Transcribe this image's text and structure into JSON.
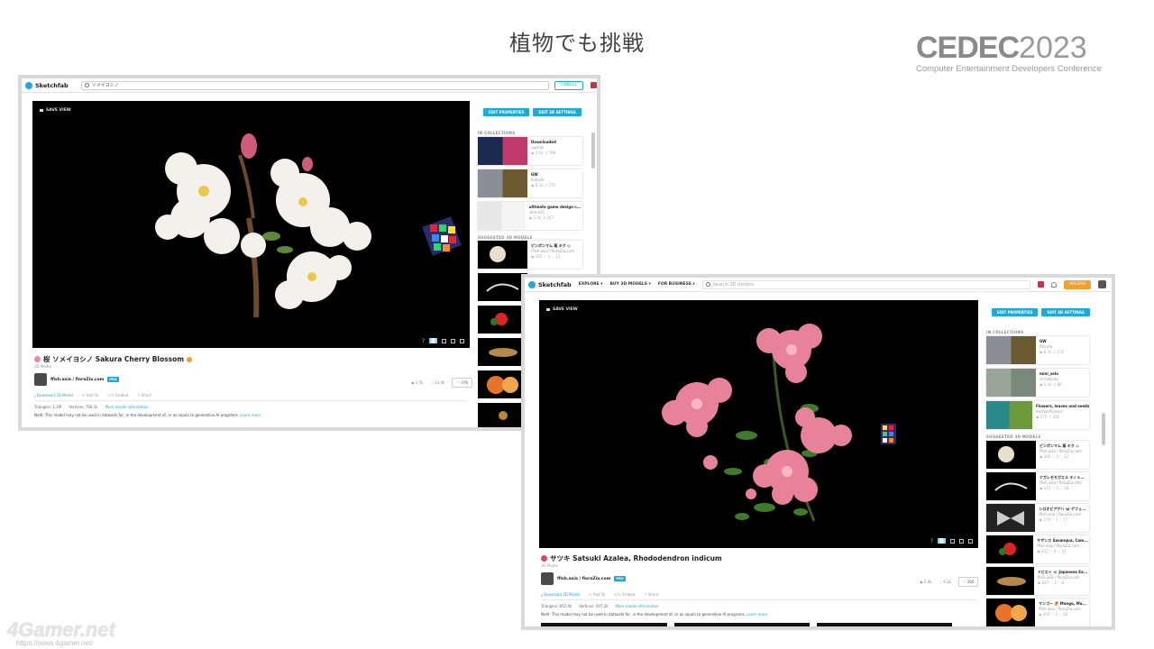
{
  "slide": {
    "title": "植物でも挑戦",
    "logo_main": "CEDEC",
    "logo_year": "2023",
    "logo_sub": "Computer Entertainment Developers Conference",
    "watermark": "4Gamer.net",
    "watermark_url": "https://www.4gamer.net/"
  },
  "colors": {
    "accent": "#1caad9",
    "upload": "#f0a030",
    "viewer_bg": "#000000"
  },
  "win1": {
    "brand": "Sketchfab",
    "search_value": "ソメイヨシノ",
    "cancel": "CANCEL",
    "save_view": "SAVE VIEW",
    "buttons": [
      "EDIT PROPERTIES",
      "EDIT 3D SETTINGS"
    ],
    "collections_head": "IN COLLECTIONS",
    "collections": [
      {
        "title": "Downloaded",
        "sub": "uuishik",
        "stats": "◉ 2.1k  ♫ 798"
      },
      {
        "title": "GW",
        "sub": "fistrufe",
        "stats": "◉ 6.1k  ♫ 272"
      },
      {
        "title": "ultimate game design c...",
        "sub": "sharnl21",
        "stats": "◉ 2.5k  ♫ 267"
      }
    ],
    "suggested_head": "SUGGESTED 3D MODELS",
    "suggested": [
      {
        "title": "ピンポンマム 菊 キク ◎",
        "sub": "Ffish.asia / floraZia.com",
        "stats": "◉ 192  ♡ 3  ◌ 12"
      }
    ],
    "model_title": "桜 ソメイヨシノ Sakura Cherry Blossom",
    "model_sub": "3D Model",
    "author": "ffish.asia / floraZia.com",
    "pro": "PRO",
    "views": "◉ 3.5k",
    "comments": "◌ 14.0k",
    "like": "♡ 379",
    "actions": [
      "⤓ Download 3D Model",
      "+ Add To",
      "</> Embed",
      "⇪ Share"
    ],
    "triangles": "Triangles: 1.1M",
    "vertices": "Vertices: 766.1k",
    "more_info": "More model information",
    "notice": "NoAI: This model may not be used in datasets for, in the development of, or as inputs to generative AI programs.",
    "learn_more": "Learn more"
  },
  "win2": {
    "brand": "Sketchfab",
    "nav": [
      "EXPLORE ▾",
      "BUY 3D MODELS ▾",
      "FOR BUSINESS ▾"
    ],
    "search_placeholder": "Search 3D models",
    "upload": "UPLOAD",
    "save_view": "SAVE VIEW",
    "buttons": [
      "EDIT PROPERTIES",
      "EDIT 3D SETTINGS"
    ],
    "collections_head": "IN COLLECTIONS",
    "collections": [
      {
        "title": "GW",
        "sub": "fistrufe",
        "stats": "◉ 6.1k  ♫ 272"
      },
      {
        "title": "mini_sela",
        "sub": "chrisbasky",
        "stats": "◉ 2.1k  ♫ 80"
      },
      {
        "title": "Flowers, leaves and seeds",
        "sub": "michaelfvisual",
        "stats": "◉ 277  ♫ 201"
      }
    ],
    "suggested_head": "SUGGESTED 3D MODELS",
    "suggested": [
      {
        "title": "ピンポンマム 菊 キク ◎",
        "sub": "ffish.asia / floraZia.com",
        "stats": "◉ 192  ♡ 3  ◌ 12"
      },
      {
        "title": "ナガレモモガエル キノメ...",
        "sub": "ffish.asia / floraZia.com",
        "stats": "◉ 372  ♡ 4  ◌ 16"
      },
      {
        "title": "シロオビアゲハ 🦋 ゲフェ...",
        "sub": "ffish.asia / floraZia.com",
        "stats": "◉ 274  ♡ 3  ◌ 17"
      },
      {
        "title": "サザンカ Sasanqua, Cam...",
        "sub": "ffish.asia / floraZia.com",
        "stats": "◉ 232  ♡ 4  ◌ 10"
      },
      {
        "title": "ドビエイ 🐟 Japanese Ea...",
        "sub": "ffish.asia / floraZia.com",
        "stats": "◉ 227  ♡ 4  ◌ 6"
      },
      {
        "title": "マンゴー 🥭 Mango, Ma...",
        "sub": "ffish.asia / floraZia.com",
        "stats": "◉ 303  ♡ 3  ◌ 16"
      }
    ],
    "model_title": "サツキ Satsuki Azalea, Rhododendron indicum",
    "model_sub": "3D Model",
    "author": "ffish.asia / floraZia.com",
    "pro": "PRO",
    "views": "◉ 2.4k",
    "comments": "◌ 4.1k",
    "like": "♡ 166",
    "actions": [
      "⤓ Download 3D Model",
      "+ Add To",
      "</> Embed",
      "⇪ Share"
    ],
    "triangles": "Triangles: 852.4k",
    "vertices": "Vertices: 597.2k",
    "more_info": "More model information",
    "notice": "NoAI: This model may not be used in datasets for, in the development of, or as inputs to generative AI programs.",
    "learn_more": "Learn more"
  }
}
